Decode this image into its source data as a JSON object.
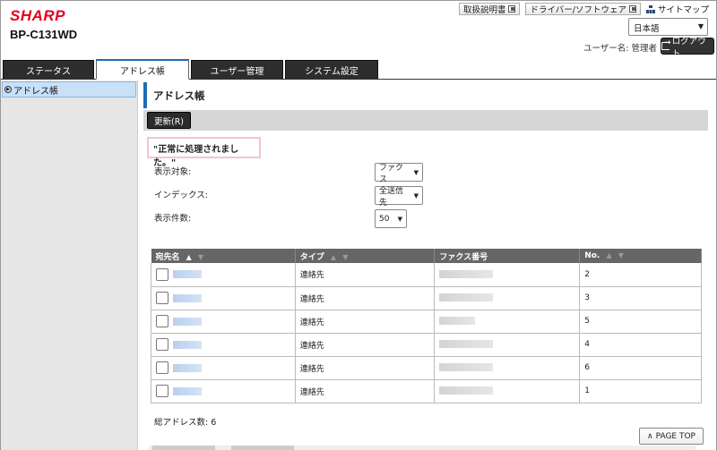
{
  "brand": {
    "logo": "SHARP",
    "model": "BP-C131WD"
  },
  "top_links": [
    {
      "label": "取扱説明書"
    },
    {
      "label": "ドライバー/ソフトウェア"
    }
  ],
  "sitemap_label": "サイトマップ",
  "language": {
    "selected": "日本語"
  },
  "user_line": "ユーザー名: 管理者",
  "logout_label": "ログアウト",
  "tabs": [
    {
      "label": "ステータス"
    },
    {
      "label": "アドレス帳"
    },
    {
      "label": "ユーザー管理"
    },
    {
      "label": "システム設定"
    }
  ],
  "sidebar": {
    "items": [
      {
        "label": "アドレス帳"
      }
    ]
  },
  "page": {
    "title": "アドレス帳",
    "refresh_label": "更新(R)",
    "message": "\"正常に処理されました。\""
  },
  "filters": {
    "target_label": "表示対象:",
    "target_value": "ファクス",
    "index_label": "インデックス:",
    "index_value": "全送信先",
    "count_label": "表示件数:",
    "count_value": "50"
  },
  "table": {
    "headers": [
      "宛先名",
      "タイプ",
      "ファクス番号",
      "No."
    ],
    "sort_up": "▲",
    "sort_down": "▼",
    "rows": [
      {
        "type": "連絡先",
        "no": "2"
      },
      {
        "type": "連絡先",
        "no": "3"
      },
      {
        "type": "連絡先",
        "no": "5"
      },
      {
        "type": "連絡先",
        "no": "4"
      },
      {
        "type": "連絡先",
        "no": "6"
      },
      {
        "type": "連絡先",
        "no": "1"
      }
    ]
  },
  "total_label": "総アドレス数:",
  "total_value": "6",
  "page_top_label": "PAGE TOP",
  "colors": {
    "accent": "#1e6bb8",
    "brand": "#e6001e",
    "tab_dark": "#2d2d2d",
    "message_border": "#f2c6cc"
  }
}
